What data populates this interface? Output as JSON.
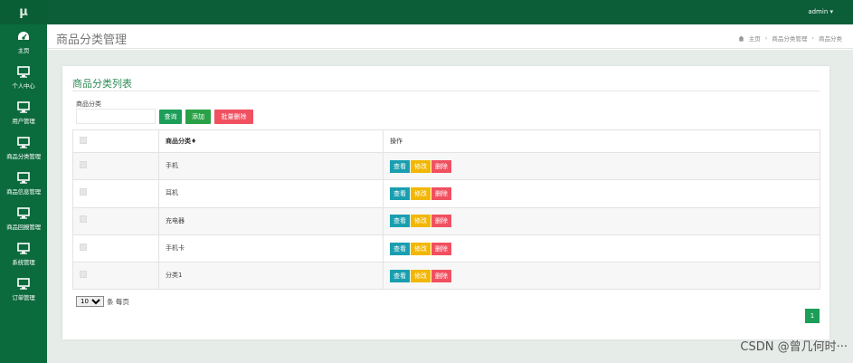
{
  "sidebar": {
    "logo": "μ",
    "items": [
      {
        "label": "主页",
        "icon": "dashboard-icon"
      },
      {
        "label": "个人中心",
        "icon": "monitor-icon"
      },
      {
        "label": "用户管理",
        "icon": "monitor-icon"
      },
      {
        "label": "商品分类管理",
        "icon": "monitor-icon"
      },
      {
        "label": "商品信息管理",
        "icon": "monitor-icon"
      },
      {
        "label": "商品回报管理",
        "icon": "monitor-icon"
      },
      {
        "label": "系统管理",
        "icon": "monitor-icon"
      },
      {
        "label": "订单管理",
        "icon": "monitor-icon"
      }
    ]
  },
  "topbar": {
    "user": "admin ▾"
  },
  "header": {
    "title": "商品分类管理",
    "breadcrumb": [
      "主页",
      "商品分类管理",
      "商品分类"
    ],
    "separator": "›"
  },
  "card": {
    "title": "商品分类列表",
    "search_label": "商品分类",
    "search_value": "",
    "buttons": {
      "search": "查询",
      "add": "添加",
      "batch_delete": "批量删除"
    }
  },
  "table": {
    "columns": [
      "",
      "商品分类♦",
      "操作"
    ],
    "rows": [
      {
        "name": "手机"
      },
      {
        "name": "耳机"
      },
      {
        "name": "充电器"
      },
      {
        "name": "手机卡"
      },
      {
        "name": "分类1"
      }
    ],
    "actions": {
      "view": "查看",
      "edit": "修改",
      "delete": "删除"
    }
  },
  "pagination": {
    "page_size": "10",
    "page_size_suffix": "条 每页",
    "current_page": "1"
  },
  "watermark": "CSDN @曾几何时···",
  "colors": {
    "sidebar": "#0b6b3d",
    "topbar": "#0b5e38",
    "primary": "#1c9e59",
    "view": "#1a9fb0",
    "edit": "#f2b705",
    "delete": "#f05060"
  }
}
